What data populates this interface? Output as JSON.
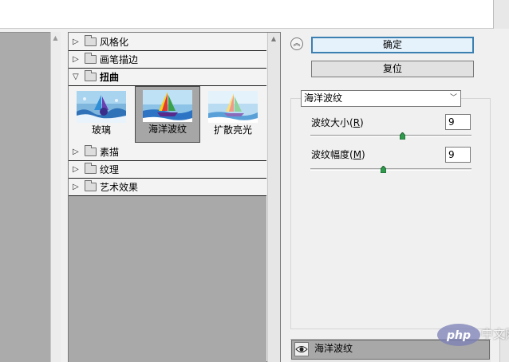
{
  "gallery": {
    "categories": [
      {
        "label": "风格化",
        "state": "collapsed"
      },
      {
        "label": "画笔描边",
        "state": "collapsed"
      },
      {
        "label": "扭曲",
        "state": "expanded"
      },
      {
        "label": "素描",
        "state": "collapsed"
      },
      {
        "label": "纹理",
        "state": "collapsed"
      },
      {
        "label": "艺术效果",
        "state": "collapsed"
      }
    ],
    "thumbnails": [
      {
        "label": "玻璃",
        "selected": false
      },
      {
        "label": "海洋波纹",
        "selected": true
      },
      {
        "label": "扩散亮光",
        "selected": false
      }
    ]
  },
  "controls": {
    "ok_label": "确定",
    "reset_label": "复位",
    "filter_select_value": "海洋波纹",
    "params": [
      {
        "label_prefix": "波纹大小(",
        "mnemonic": "R",
        "label_suffix": ")",
        "value": "9",
        "slider_level": 0.57
      },
      {
        "label_prefix": "波纹幅度(",
        "mnemonic": "M",
        "label_suffix": ")",
        "value": "9",
        "slider_level": 0.45
      }
    ]
  },
  "layers": {
    "items": [
      {
        "label": "海洋波纹",
        "visible": true
      }
    ]
  },
  "watermark": {
    "text": "中文网",
    "logo_text": "php"
  },
  "colors": {
    "accent_border": "#3c7fb1",
    "gallery_bg": "#f3f3f3",
    "selected_thumb": "#a6a6a6",
    "panel_gray": "#a9a9a9",
    "slider_thumb": "#2f9a4c"
  }
}
